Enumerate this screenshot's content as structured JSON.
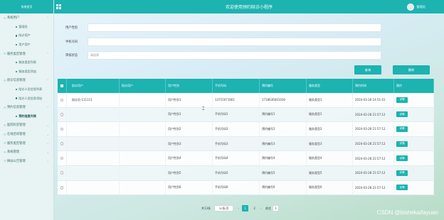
{
  "header": {
    "title": "欢迎使用预约陪诊小程序",
    "username": "管理员"
  },
  "sidebar": {
    "top": "系统首页",
    "items": [
      {
        "label": "系统用户",
        "icon": "user-icon",
        "children": [
          "管理员",
          "陪诊用户",
          "用户用户"
        ]
      },
      {
        "label": "服务类型管理",
        "icon": "list-icon",
        "children": [
          "服务类型列表",
          "服务类型添加"
        ]
      },
      {
        "label": "陪诊信息管理",
        "icon": "user-icon",
        "children": [
          "陪诊人员信息列表",
          "陪诊人员信息添加"
        ]
      },
      {
        "label": "预约信息管理",
        "icon": "user-icon",
        "children": [
          "预约信息列表"
        ]
      },
      {
        "label": "医院科室管理",
        "icon": "user-icon",
        "children": []
      },
      {
        "label": "在线咨询管理",
        "icon": "user-icon",
        "children": []
      },
      {
        "label": "服务类型管理",
        "icon": "user-icon",
        "children": []
      },
      {
        "label": "系统管理",
        "icon": "user-icon",
        "children": []
      },
      {
        "label": "网站公告管理",
        "icon": "user-icon",
        "children": []
      }
    ]
  },
  "filters": {
    "field1": {
      "label": "用户性别",
      "placeholder": ""
    },
    "field2": {
      "label": "手机号码",
      "placeholder": ""
    },
    "field3": {
      "label": "审核状态",
      "placeholder": "请选择"
    }
  },
  "actions": {
    "query": "查询",
    "delete": "删除"
  },
  "table": {
    "headers": [
      "陪诊用户",
      "陪诊用户",
      "用户性别",
      "手机号码",
      "预约编号",
      "服务类型",
      "预约时间",
      "操作"
    ],
    "detail_label": "详情",
    "rows": [
      [
        "陪诊员-111111",
        "",
        "用户性别1",
        "13715071661",
        "1718636001030",
        "服务类型1",
        "2024-03-28 14:51:41"
      ],
      [
        "",
        "",
        "用户性别1",
        "手机号码1",
        "预约编号1",
        "服务类型1",
        "2024-03-28 21:57:12"
      ],
      [
        "",
        "",
        "用户性别2",
        "手机号码2",
        "预约编号2",
        "服务类型2",
        "2024-03-28 21:57:12"
      ],
      [
        "",
        "",
        "用户性别3",
        "手机号码3",
        "预约编号3",
        "服务类型3",
        "2024-03-28 21:57:12"
      ],
      [
        "",
        "",
        "用户性别4",
        "手机号码4",
        "预约编号4",
        "服务类型4",
        "2024-03-28 21:57:12"
      ],
      [
        "",
        "",
        "用户性别5",
        "手机号码5",
        "预约编号5",
        "服务类型5",
        "2024-03-28 21:57:12"
      ],
      [
        "",
        "",
        "用户性别6",
        "手机号码6",
        "预约编号6",
        "服务类型6",
        "2024-03-28 21:57:12"
      ]
    ]
  },
  "pagination": {
    "total": "共13条",
    "page_size": "10条/页",
    "pages": [
      "1",
      "2"
    ],
    "current": "1",
    "goto_label": "前往",
    "goto_value": "1"
  },
  "watermark": "CSDN @bishekaifayuan",
  "colors": {
    "accent": "#1cb3b1"
  }
}
